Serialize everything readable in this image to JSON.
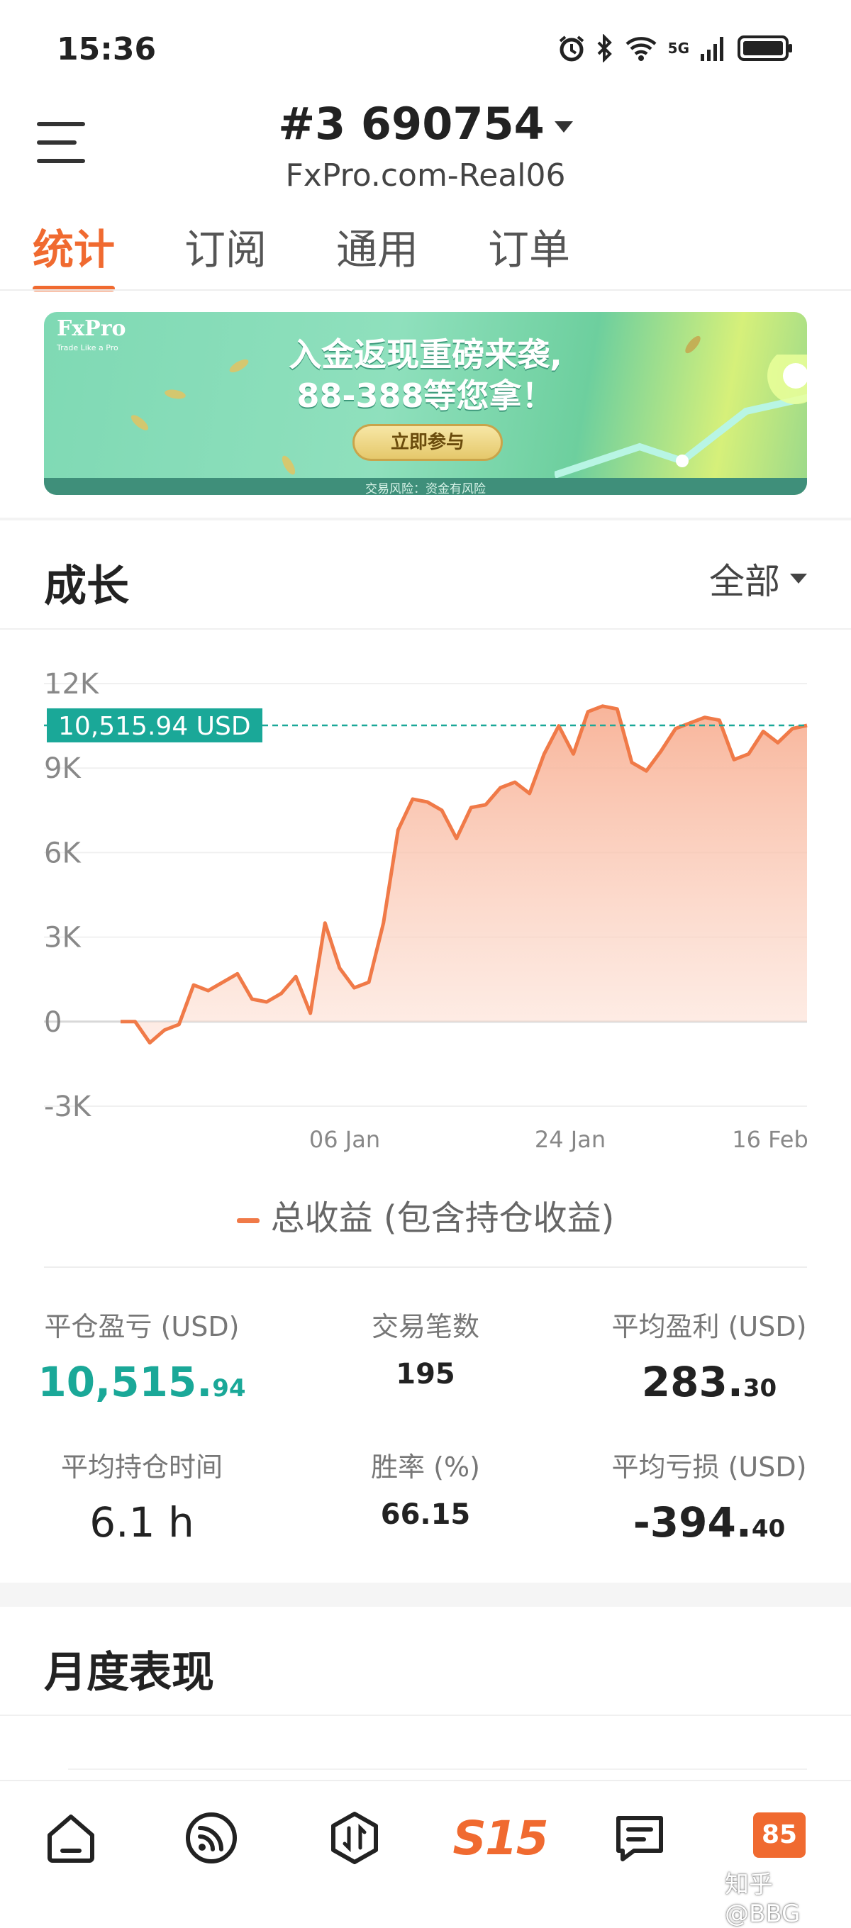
{
  "status_bar": {
    "time": "15:36",
    "network": "5G"
  },
  "header": {
    "account_title": "#3  690754",
    "server": "FxPro.com-Real06"
  },
  "tabs": [
    {
      "label": "统计",
      "active": true
    },
    {
      "label": "订阅",
      "active": false
    },
    {
      "label": "通用",
      "active": false
    },
    {
      "label": "订单",
      "active": false
    }
  ],
  "banner": {
    "logo": "FxPro",
    "logo_sub": "Trade Like a Pro",
    "line1": "入金返现重磅来袭,",
    "line2": "88-388等您拿！",
    "button": "立即参与",
    "footer": "交易风险：资金有风险"
  },
  "growth": {
    "title": "成长",
    "range": "全部",
    "current_label": "10,515.94 USD",
    "legend": "总收益 (包含持仓收益)"
  },
  "chart_data": {
    "type": "area",
    "y_ticks": [
      "12K",
      "9K",
      "6K",
      "3K",
      "0",
      "-3K"
    ],
    "ylim": [
      -3000,
      12000
    ],
    "x_ticks": [
      "06 Jan",
      "24 Jan",
      "16 Feb"
    ],
    "reference_value": 10515.94,
    "series": [
      {
        "name": "总收益 (包含持仓收益)",
        "color": "#f07a48",
        "values": [
          0,
          0,
          -750,
          -300,
          -100,
          1300,
          1100,
          1400,
          1700,
          800,
          700,
          1000,
          1600,
          300,
          3500,
          1900,
          1200,
          1400,
          3500,
          6800,
          7900,
          7800,
          7500,
          6500,
          7600,
          7700,
          8300,
          8500,
          8100,
          9500,
          10500,
          9500,
          11000,
          11200,
          11100,
          9200,
          8900,
          9600,
          10400,
          10600,
          10800,
          10700,
          9300,
          9500,
          10300,
          9900,
          10400,
          10515.94
        ]
      }
    ]
  },
  "stats": {
    "closed_pnl": {
      "label": "平仓盈亏 (USD)",
      "int": "10,515.",
      "dec": "94"
    },
    "trades": {
      "label": "交易笔数",
      "value": "195"
    },
    "avg_profit": {
      "label": "平均盈利 (USD)",
      "int": "283.",
      "dec": "30"
    },
    "avg_hold": {
      "label": "平均持仓时间",
      "value": "6.1 h"
    },
    "win_rate": {
      "label": "胜率 (%)",
      "value": "66.15"
    },
    "avg_loss": {
      "label": "平均亏损 (USD)",
      "int": "-394.",
      "dec": "40"
    }
  },
  "monthly": {
    "title": "月度表现"
  },
  "bottom_nav": {
    "s15_label": "S15",
    "badge": "85"
  },
  "watermark": "知乎 @BBG",
  "colors": {
    "accent": "#f06a30",
    "teal": "#1aa898",
    "chart_line": "#f07a48"
  }
}
